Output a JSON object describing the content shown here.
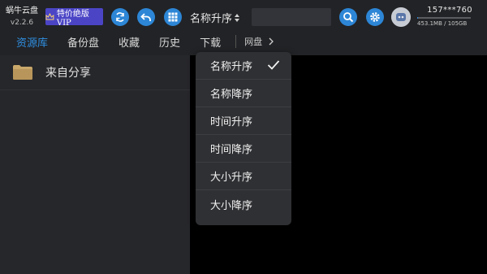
{
  "app": {
    "name": "蜗牛云盘",
    "version": "v2.2.6"
  },
  "vip_button": {
    "label": "特价绝版VIP"
  },
  "toolbar": {
    "sort_label": "名称升序",
    "search_placeholder": ""
  },
  "account": {
    "user_id": "157***760",
    "storage": "453.1MB / 105GB",
    "usage_fraction": 0.004
  },
  "tabs": [
    {
      "label": "资源库",
      "active": true
    },
    {
      "label": "备份盘"
    },
    {
      "label": "收藏"
    },
    {
      "label": "历史"
    },
    {
      "label": "下载"
    },
    {
      "label": "网盘"
    }
  ],
  "sidebar": {
    "folders": [
      {
        "label": "来自分享",
        "icon": "folder-icon"
      }
    ]
  },
  "sort_menu": {
    "items": [
      {
        "label": "名称升序",
        "selected": true
      },
      {
        "label": "名称降序"
      },
      {
        "label": "时间升序"
      },
      {
        "label": "时间降序"
      },
      {
        "label": "大小升序"
      },
      {
        "label": "大小降序"
      }
    ]
  },
  "colors": {
    "accent": "#2d86d6",
    "active_tab": "#2f8fe3",
    "vip_bg": "#4b45c6",
    "folder": "#c9a86a"
  },
  "icons": [
    "refresh-icon",
    "back-icon",
    "grid-icon",
    "search-icon",
    "settings-icon",
    "check-icon",
    "chevron-right-icon"
  ]
}
